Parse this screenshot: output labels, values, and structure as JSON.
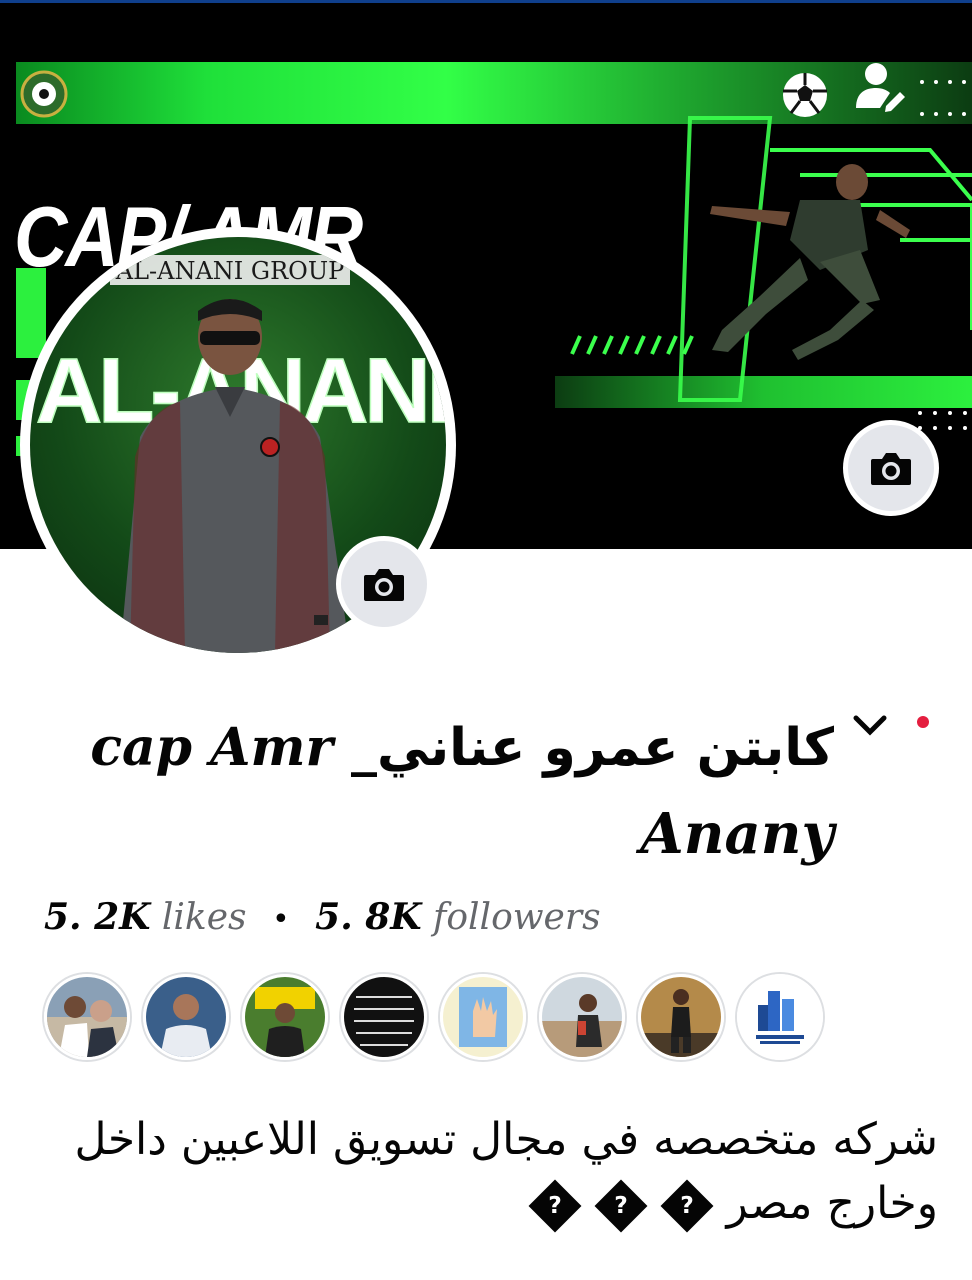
{
  "cover": {
    "title": "CAP/ AMR",
    "camera_icon": "camera-icon"
  },
  "avatar": {
    "banner_text": "AL-ANANI GROUP",
    "sign_text": "AL-ANANI",
    "camera_icon": "camera-icon"
  },
  "profile": {
    "name_line1_arabic": "كابتن عمرو عناني_",
    "name_line1_latin": "cap Amr",
    "name_line2": "Anany",
    "likes_count": "5. 2K",
    "likes_label": "likes",
    "separator": "•",
    "followers_count": "5. 8K",
    "followers_label": "followers",
    "bio_line1": "شركه متخصصه في مجال تسويق اللاعبين داخل",
    "bio_line2": "وخارج مصر",
    "bio_glyph": "?"
  },
  "friends": [
    {
      "name": "friend-1"
    },
    {
      "name": "friend-2"
    },
    {
      "name": "friend-3"
    },
    {
      "name": "friend-4"
    },
    {
      "name": "friend-5"
    },
    {
      "name": "friend-6"
    },
    {
      "name": "friend-7"
    },
    {
      "name": "friend-8"
    }
  ],
  "colors": {
    "accent_green": "#32ff47",
    "red_dot": "#e41e3f",
    "secondary_text": "#65676b",
    "button_gray": "#e4e6eb"
  }
}
